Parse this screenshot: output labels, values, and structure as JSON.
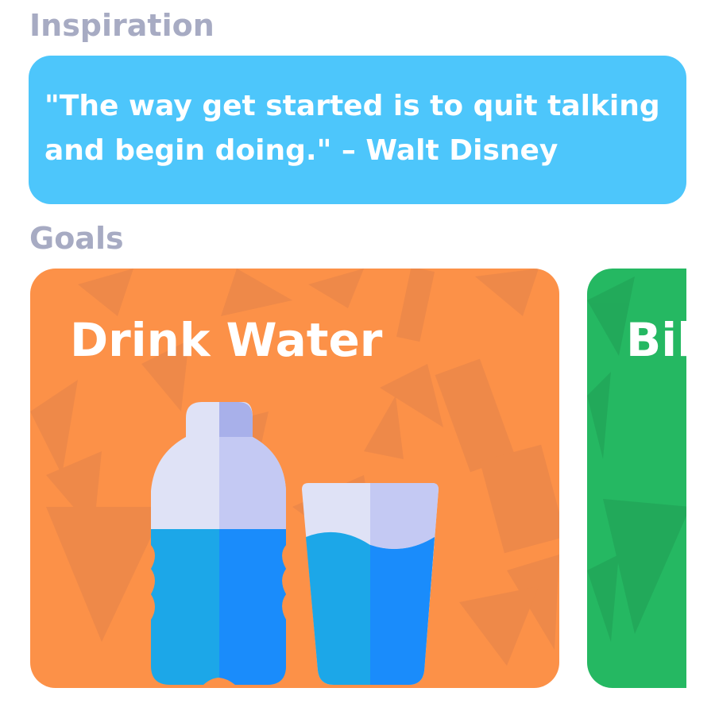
{
  "inspiration": {
    "title": "Inspiration",
    "quote": "\"The way get started is to quit talking and begin doing.\" – Walt Disney",
    "card_color": "#4dc6fb"
  },
  "goals": {
    "title": "Goals",
    "items": [
      {
        "label": "Drink Water",
        "color": "#fc9148",
        "icon": "water-bottle-and-glass-icon"
      },
      {
        "label": "Bik",
        "color": "#25b862"
      }
    ]
  },
  "colors": {
    "section_title": "#a7abc3"
  }
}
